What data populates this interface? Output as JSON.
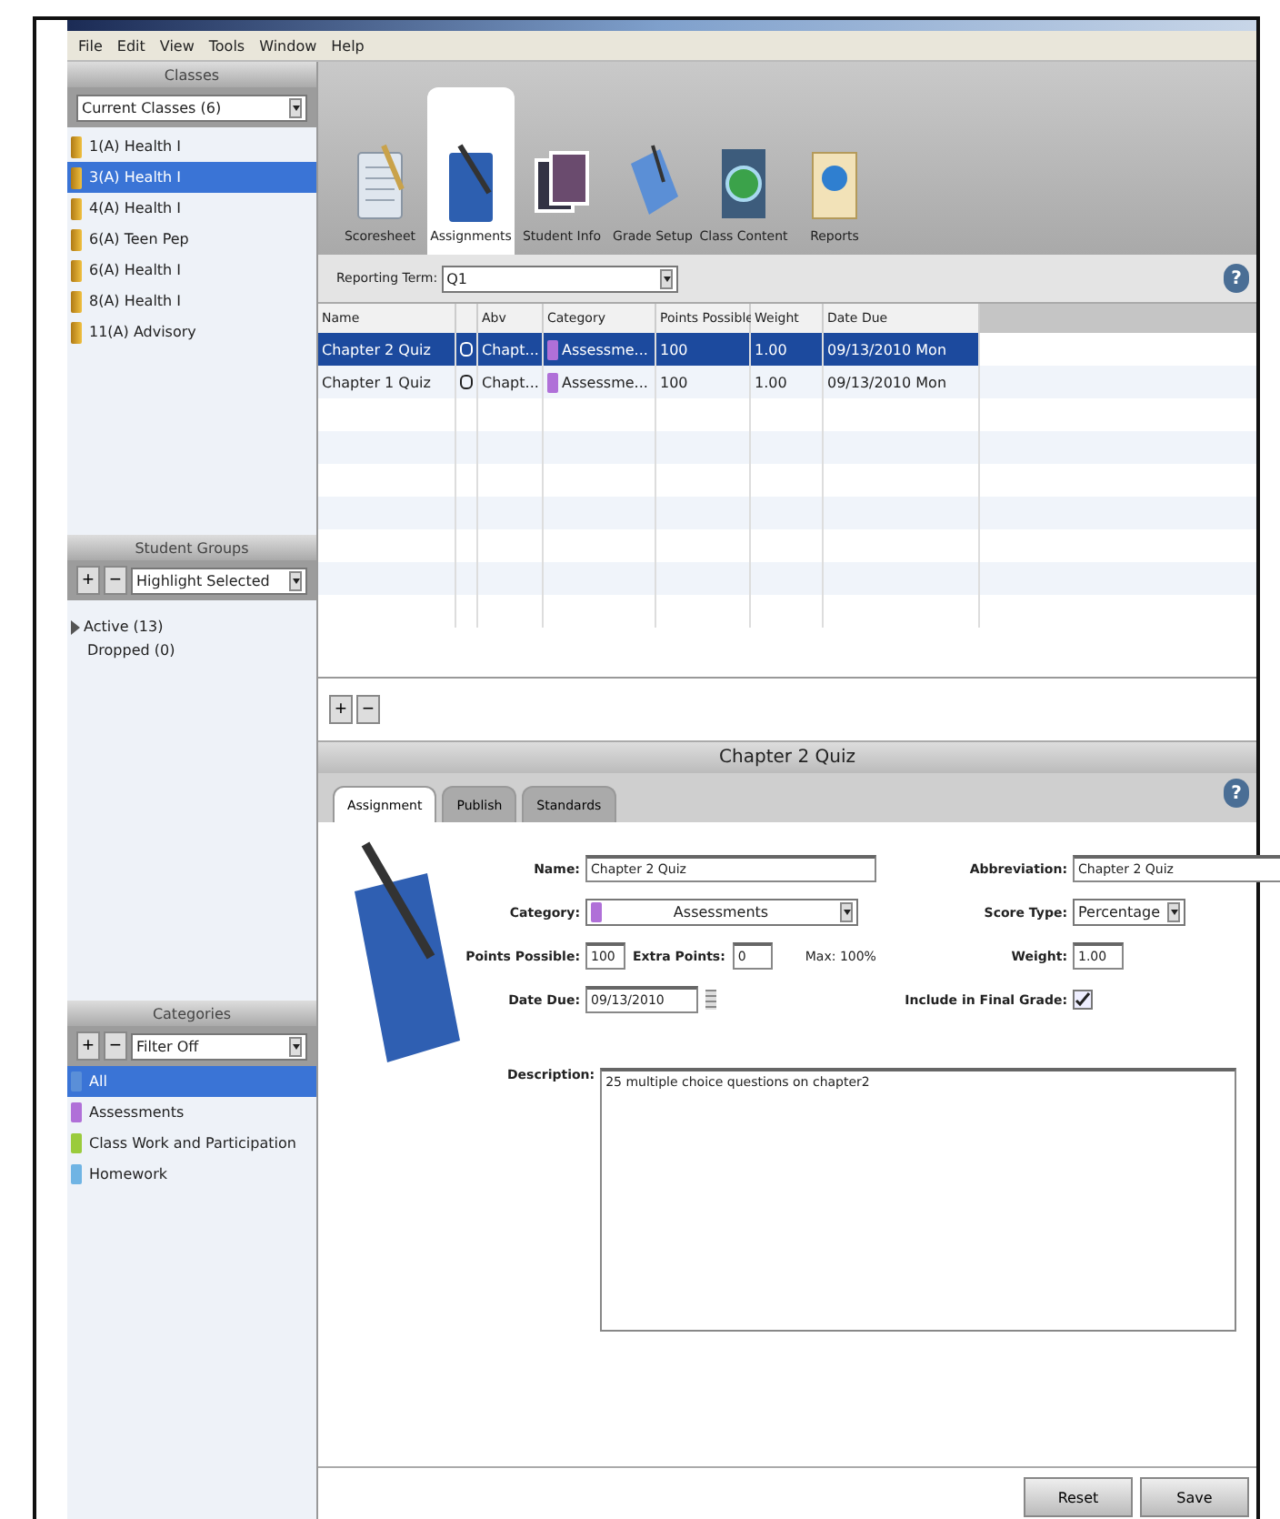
{
  "menu": [
    "File",
    "Edit",
    "View",
    "Tools",
    "Window",
    "Help"
  ],
  "sidebar": {
    "classes": {
      "title": "Classes",
      "filter": "Current Classes (6)",
      "items": [
        {
          "name": "1(A) Health I",
          "selected": false
        },
        {
          "name": "3(A) Health I",
          "selected": true
        },
        {
          "name": "4(A) Health I",
          "selected": false
        },
        {
          "name": "6(A) Teen Pep",
          "selected": false
        },
        {
          "name": "6(A) Health I",
          "selected": false
        },
        {
          "name": "8(A) Health I",
          "selected": false
        },
        {
          "name": "11(A) Advisory",
          "selected": false
        }
      ]
    },
    "student_groups": {
      "title": "Student Groups",
      "controls": [
        "+",
        "−"
      ],
      "filter": "Highlight Selected",
      "tree": [
        {
          "label": "Active (13)",
          "expanded": false
        },
        {
          "label": "Dropped (0)"
        }
      ]
    },
    "categories": {
      "title": "Categories",
      "controls": [
        "+",
        "−"
      ],
      "filter": "Filter Off",
      "items": [
        {
          "name": "All",
          "color": "#5a8fd8",
          "selected": true
        },
        {
          "name": "Assessments",
          "color": "#b070d8",
          "selected": false
        },
        {
          "name": "Class Work and Participation",
          "color": "#9acb3c",
          "selected": false
        },
        {
          "name": "Homework",
          "color": "#6fb4e4",
          "selected": false
        }
      ]
    }
  },
  "toolbar": [
    {
      "label": "Scoresheet",
      "kind": "sheet",
      "selected": false
    },
    {
      "label": "Assignments",
      "kind": "book",
      "selected": true
    },
    {
      "label": "Student Info",
      "kind": "photos",
      "selected": false
    },
    {
      "label": "Grade Setup",
      "kind": "setup",
      "selected": false
    },
    {
      "label": "Class Content",
      "kind": "globe",
      "selected": false
    },
    {
      "label": "Reports",
      "kind": "report",
      "selected": false
    }
  ],
  "reporting_term": {
    "label": "Reporting Term:",
    "value": "Q1",
    "help": "?"
  },
  "table": {
    "columns": [
      "Name",
      "",
      "Abv",
      "Category",
      "Points Possible",
      "Weight",
      "Date Due"
    ],
    "rows": [
      {
        "name": "Chapter 2 Quiz",
        "abv": "Chapt...",
        "category": {
          "label": "Assessme...",
          "color": "#b070d8"
        },
        "points": "100",
        "weight": "1.00",
        "due": "09/13/2010 Mon",
        "selected": true
      },
      {
        "name": "Chapter 1 Quiz",
        "abv": "Chapt...",
        "category": {
          "label": "Assessme...",
          "color": "#b070d8"
        },
        "points": "100",
        "weight": "1.00",
        "due": "09/13/2010 Mon",
        "selected": false
      }
    ]
  },
  "table_controls": [
    "+",
    "−"
  ],
  "detail": {
    "title": "Chapter 2 Quiz",
    "tabs": [
      {
        "label": "Assignment",
        "selected": true
      },
      {
        "label": "Publish",
        "selected": false
      },
      {
        "label": "Standards",
        "selected": false
      }
    ],
    "name_label": "Name:",
    "name": "Chapter 2 Quiz",
    "abbreviation_label": "Abbreviation:",
    "abbreviation": "Chapter 2 Quiz",
    "help": "?",
    "category_label": "Category:",
    "category": {
      "label": "Assessments",
      "color": "#b070d8"
    },
    "score_type_label": "Score Type:",
    "score_type": "Percentage",
    "points_label": "Points Possible:",
    "points": "100",
    "extra_label": "Extra Points:",
    "extra": "0",
    "max": "Max: 100%",
    "weight_label": "Weight:",
    "weight": "1.00",
    "date_label": "Date Due:",
    "date": "09/13/2010",
    "final_label": "Include in Final Grade:",
    "final_checked": true,
    "description_label": "Description:",
    "description": "25 multiple choice questions on chapter2"
  },
  "buttons": [
    "Reset",
    "Save"
  ]
}
